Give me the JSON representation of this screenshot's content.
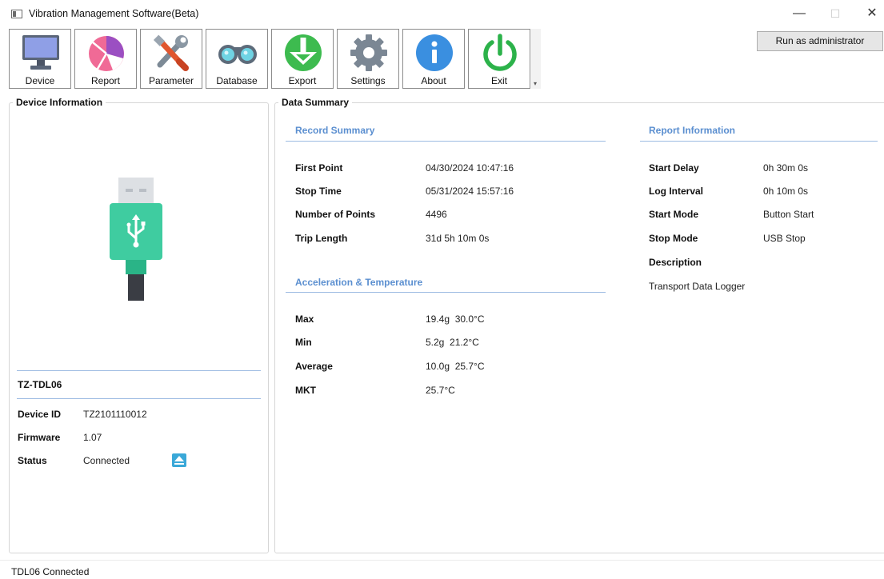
{
  "window": {
    "title": "Vibration Management Software(Beta)",
    "minimize": "—",
    "maximize": "☐",
    "close": "✕"
  },
  "toolbar": {
    "device": "Device",
    "report": "Report",
    "parameter": "Parameter",
    "database": "Database",
    "export": "Export",
    "settings": "Settings",
    "about": "About",
    "exit": "Exit",
    "overflow": "▾"
  },
  "run_as_admin": "Run as administrator",
  "device_info": {
    "title": "Device Information",
    "model": "TZ-TDL06",
    "rows": [
      {
        "label": "Device ID",
        "value": "TZ2101110012"
      },
      {
        "label": "Firmware",
        "value": "1.07"
      },
      {
        "label": "Status",
        "value": "Connected"
      }
    ],
    "eject_icon": "eject-icon"
  },
  "data_summary": {
    "title": "Data Summary",
    "record_summary": {
      "heading": "Record Summary",
      "rows": [
        {
          "label": "First Point",
          "value": "04/30/2024 10:47:16"
        },
        {
          "label": "Stop Time",
          "value": "05/31/2024 15:57:16"
        },
        {
          "label": "Number of Points",
          "value": "4496"
        },
        {
          "label": "Trip Length",
          "value": "31d 5h 10m 0s"
        }
      ]
    },
    "accel_temp": {
      "heading": "Acceleration & Temperature",
      "rows": [
        {
          "label": "Max",
          "value": "19.4g  30.0°C"
        },
        {
          "label": "Min",
          "value": "5.2g  21.2°C"
        },
        {
          "label": "Average",
          "value": "10.0g  25.7°C"
        },
        {
          "label": "MKT",
          "value": "25.7°C"
        }
      ]
    },
    "report_info": {
      "heading": "Report Information",
      "rows": [
        {
          "label": "Start Delay",
          "value": "0h 30m 0s"
        },
        {
          "label": "Log Interval",
          "value": "0h 10m 0s"
        },
        {
          "label": "Start Mode",
          "value": "Button Start"
        },
        {
          "label": "Stop Mode",
          "value": "USB Stop"
        }
      ],
      "description_label": "Description",
      "description_value": "Transport Data Logger"
    }
  },
  "status_bar": "TDL06 Connected",
  "colors": {
    "section_heading": "#5b8fd0",
    "usb_body": "#3fcca0",
    "export_green": "#3dbb4f",
    "exit_green": "#2cb24a",
    "about_blue": "#3a8fe0"
  }
}
